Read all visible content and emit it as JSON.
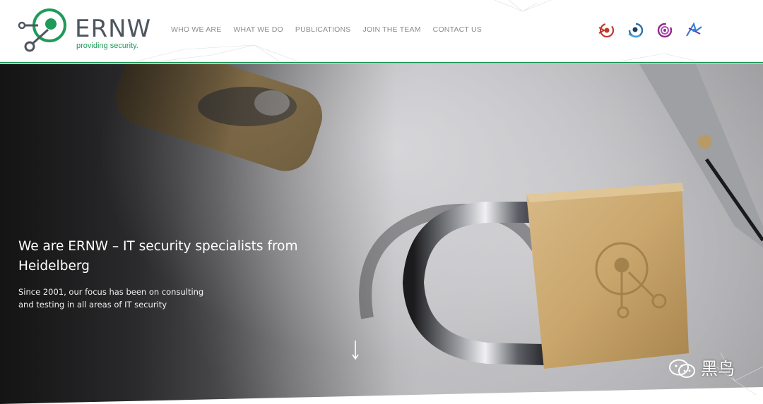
{
  "brand": {
    "name": "ERNW",
    "tagline": "providing security.",
    "accent": "#1e9b5a",
    "logo_icon": "ernw-logo-icon"
  },
  "nav": {
    "items": [
      {
        "label": "WHO WE ARE"
      },
      {
        "label": "WHAT WE DO"
      },
      {
        "label": "PUBLICATIONS"
      },
      {
        "label": "JOIN THE TEAM"
      },
      {
        "label": "CONTACT US"
      }
    ]
  },
  "partners": [
    {
      "icon": "partner-red-swirl-icon",
      "color": "#c0392b"
    },
    {
      "icon": "partner-blue-swirl-icon",
      "color": "#2f6fa8"
    },
    {
      "icon": "partner-purple-swirl-icon",
      "color": "#8e2b8e"
    },
    {
      "icon": "partner-star-icon",
      "color": "#3b7dd8"
    }
  ],
  "hero": {
    "title": "We are ERNW – IT security specialists from Heidelberg",
    "subtitle": "Since 2001, our focus has been on consulting and testing in all areas of IT security",
    "scroll_icon": "arrow-down-icon"
  },
  "watermark": {
    "text": "黑鸟",
    "icon": "wechat-icon"
  }
}
